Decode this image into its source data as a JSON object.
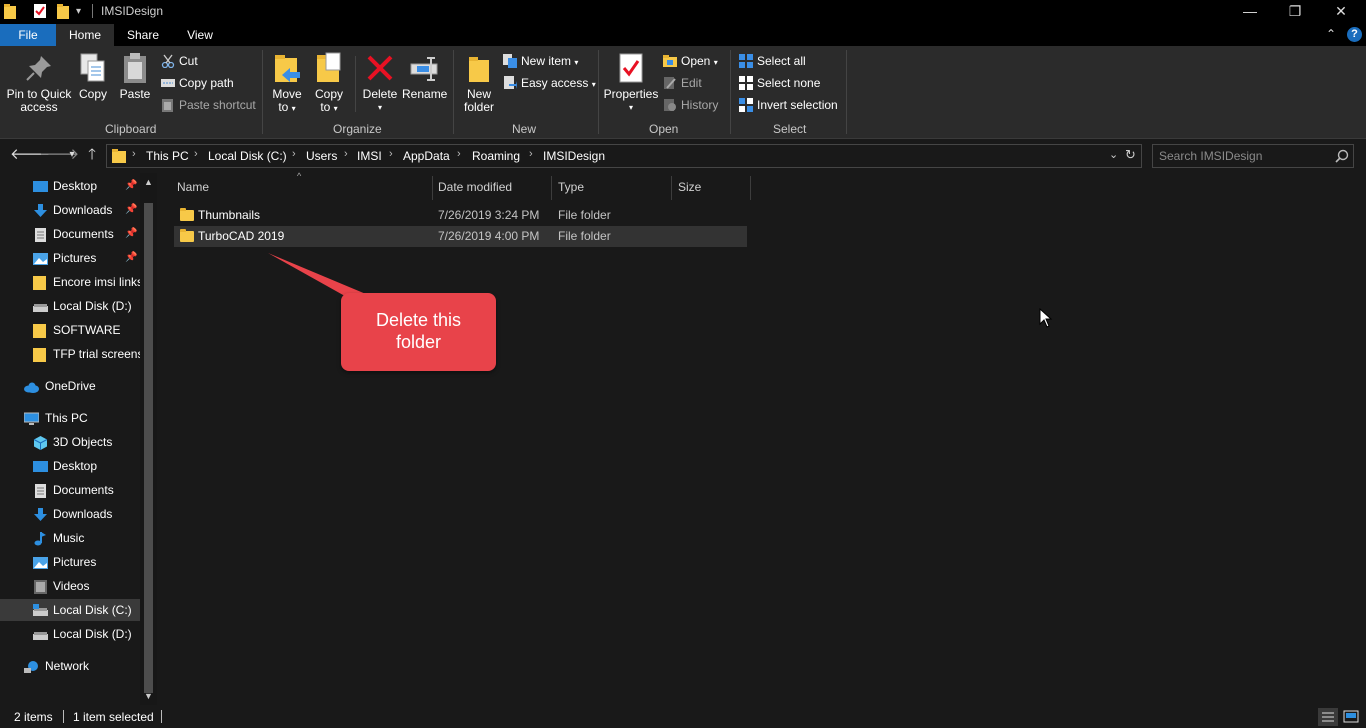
{
  "window": {
    "title": "IMSIDesign",
    "minimize_glyph": "—",
    "restore_glyph": "❐",
    "close_glyph": "✕"
  },
  "tabs": [
    "File",
    "Home",
    "Share",
    "View"
  ],
  "ribbon": {
    "clipboard": {
      "label": "Clipboard",
      "pin": "Pin to Quick access",
      "pin_l1": "Pin to Quick",
      "pin_l2": "access",
      "copy": "Copy",
      "paste": "Paste",
      "cut": "Cut",
      "copy_path": "Copy path",
      "paste_shortcut": "Paste shortcut"
    },
    "organize": {
      "label": "Organize",
      "move_l1": "Move",
      "move_l2": "to",
      "copy_l1": "Copy",
      "copy_l2": "to",
      "delete": "Delete",
      "rename": "Rename"
    },
    "new": {
      "label": "New",
      "folder_l1": "New",
      "folder_l2": "folder",
      "new_item": "New item",
      "easy_access": "Easy access"
    },
    "open": {
      "label": "Open",
      "properties": "Properties",
      "open": "Open",
      "edit": "Edit",
      "history": "History"
    },
    "select": {
      "label": "Select",
      "select_all": "Select all",
      "select_none": "Select none",
      "invert": "Invert selection"
    }
  },
  "address": {
    "breadcrumbs": [
      "This PC",
      "Local Disk (C:)",
      "Users",
      "IMSI",
      "AppData",
      "Roaming",
      "IMSIDesign"
    ],
    "search_placeholder": "Search IMSIDesign"
  },
  "nav": {
    "quick_access": [
      {
        "label": "Desktop",
        "icon": "desktop-icon",
        "pinned": true
      },
      {
        "label": "Downloads",
        "icon": "download-arrow-icon",
        "pinned": true
      },
      {
        "label": "Documents",
        "icon": "document-icon",
        "pinned": true
      },
      {
        "label": "Pictures",
        "icon": "pictures-icon",
        "pinned": true
      },
      {
        "label": "Encore imsi links",
        "icon": "folder-icon",
        "pinned": false
      },
      {
        "label": "Local Disk (D:)",
        "icon": "drive-icon",
        "pinned": false
      },
      {
        "label": "SOFTWARE",
        "icon": "folder-icon",
        "pinned": false
      },
      {
        "label": "TFP trial screenshots",
        "icon": "folder-icon",
        "pinned": false
      }
    ],
    "onedrive": "OneDrive",
    "this_pc": "This PC",
    "this_pc_items": [
      {
        "label": "3D Objects",
        "icon": "3d-objects-icon"
      },
      {
        "label": "Desktop",
        "icon": "desktop-icon"
      },
      {
        "label": "Documents",
        "icon": "document-icon"
      },
      {
        "label": "Downloads",
        "icon": "download-arrow-icon"
      },
      {
        "label": "Music",
        "icon": "music-note-icon"
      },
      {
        "label": "Pictures",
        "icon": "pictures-icon"
      },
      {
        "label": "Videos",
        "icon": "video-icon"
      },
      {
        "label": "Local Disk (C:)",
        "icon": "drive-icon",
        "selected": true
      },
      {
        "label": "Local Disk (D:)",
        "icon": "drive-icon"
      }
    ],
    "network": "Network",
    "pin_glyph": "📌"
  },
  "columns": [
    "Name",
    "Date modified",
    "Type",
    "Size"
  ],
  "files": [
    {
      "name": "Thumbnails",
      "modified": "7/26/2019 3:24 PM",
      "type": "File folder",
      "size": "",
      "selected": false
    },
    {
      "name": "TurboCAD 2019",
      "modified": "7/26/2019 4:00 PM",
      "type": "File folder",
      "size": "",
      "selected": true
    }
  ],
  "callout": {
    "line1": "Delete this",
    "line2": "folder",
    "color": "#e8434a"
  },
  "status": {
    "items": "2 items",
    "selected": "1 item selected"
  },
  "colors": {
    "accent": "#1a6dbd",
    "folder": "#f7c948",
    "delete_red": "#e81123"
  }
}
